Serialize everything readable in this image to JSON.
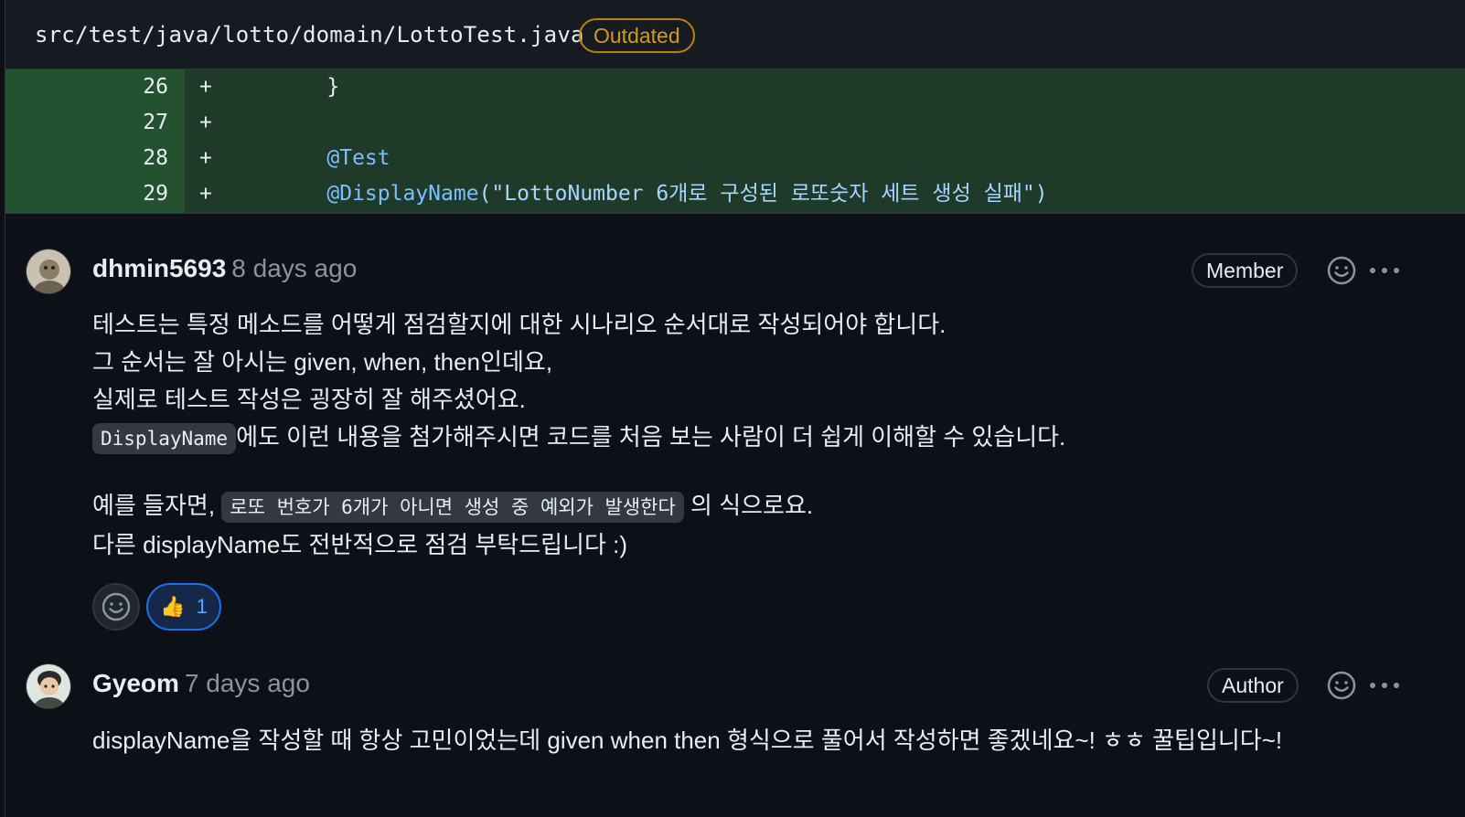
{
  "file": {
    "path": "src/test/java/lotto/domain/LottoTest.java",
    "badge": "Outdated"
  },
  "diff": {
    "lines": [
      {
        "num": "26",
        "sign": "+",
        "code": "    }"
      },
      {
        "num": "27",
        "sign": "+",
        "code": ""
      },
      {
        "num": "28",
        "sign": "+",
        "code": "    @Test"
      },
      {
        "num": "29",
        "sign": "+",
        "code_anno": "    @DisplayName",
        "code_str": "(\"LottoNumber 6개로 구성된 로또숫자 세트 생성 실패\")"
      }
    ]
  },
  "comments": [
    {
      "author": "dhmin5693",
      "time": "8 days ago",
      "role": "Member",
      "lines": [
        "테스트는 특정 메소드를 어떻게 점검할지에 대한 시나리오 순서대로 작성되어야 합니다.",
        "그 순서는 잘 아시는 given, when, then인데요,",
        "실제로 테스트 작성은 굉장히 잘 해주셨어요.",
        "에도 이런 내용을 첨가해주시면 코드를 처음 보는 사람이 더 쉽게 이해할 수 있습니다.",
        "예를 들자면, ",
        " 의 식으로요.",
        "다른 displayName도 전반적으로 점검 부탁드립니다 :)"
      ],
      "code_displayname": "DisplayName",
      "code_example": "로또 번호가 6개가 아니면 생성 중 예외가 발생한다",
      "reactions": [
        {
          "emoji": "👍",
          "count": "1"
        }
      ]
    },
    {
      "author": "Gyeom",
      "time": "7 days ago",
      "role": "Author",
      "text": "displayName을 작성할 때 항상 고민이었는데 given when then 형식으로 풀어서 작성하면 좋겠네요~! ㅎㅎ 꿀팁입니다~!"
    }
  ],
  "icons": {
    "emoji": "smiley-icon",
    "more": "kebab-horizontal-icon"
  },
  "colors": {
    "background": "#0d1117",
    "diff_added": "#1f3a28",
    "outdated": "#d29922",
    "reaction_active": "#1f6feb"
  }
}
